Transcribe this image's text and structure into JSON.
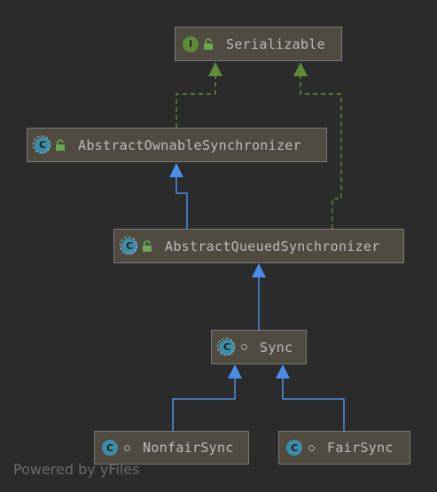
{
  "nodes": {
    "serializable": {
      "label": "Serializable",
      "kind": "interface",
      "badge": "I",
      "modifier": "lock-icon"
    },
    "aos": {
      "label": "AbstractOwnableSynchronizer",
      "kind": "abstract-class",
      "badge": "C",
      "modifier": "lock-icon"
    },
    "aqs": {
      "label": "AbstractQueuedSynchronizer",
      "kind": "abstract-class",
      "badge": "C",
      "modifier": "lock-icon"
    },
    "sync": {
      "label": "Sync",
      "kind": "abstract-class",
      "badge": "C",
      "modifier": "package-private-dot"
    },
    "nonfair": {
      "label": "NonfairSync",
      "kind": "class",
      "badge": "C",
      "modifier": "package-private-dot"
    },
    "fair": {
      "label": "FairSync",
      "kind": "class",
      "badge": "C",
      "modifier": "package-private-dot"
    }
  },
  "edges": [
    {
      "from": "aos",
      "to": "serializable",
      "type": "implements"
    },
    {
      "from": "aqs",
      "to": "serializable",
      "type": "implements"
    },
    {
      "from": "aqs",
      "to": "aos",
      "type": "extends"
    },
    {
      "from": "sync",
      "to": "aqs",
      "type": "extends"
    },
    {
      "from": "nonfair",
      "to": "sync",
      "type": "extends"
    },
    {
      "from": "fair",
      "to": "sync",
      "type": "extends"
    }
  ],
  "colors": {
    "background": "#2b2b2b",
    "node_fill": "#4f4b41",
    "extends_edge": "#4a8fe7",
    "implements_edge": "#5f8a3c",
    "interface_badge": "#5f8a3c",
    "class_badge": "#3e8ca6"
  },
  "footer": {
    "text": "Powered by yFiles"
  }
}
